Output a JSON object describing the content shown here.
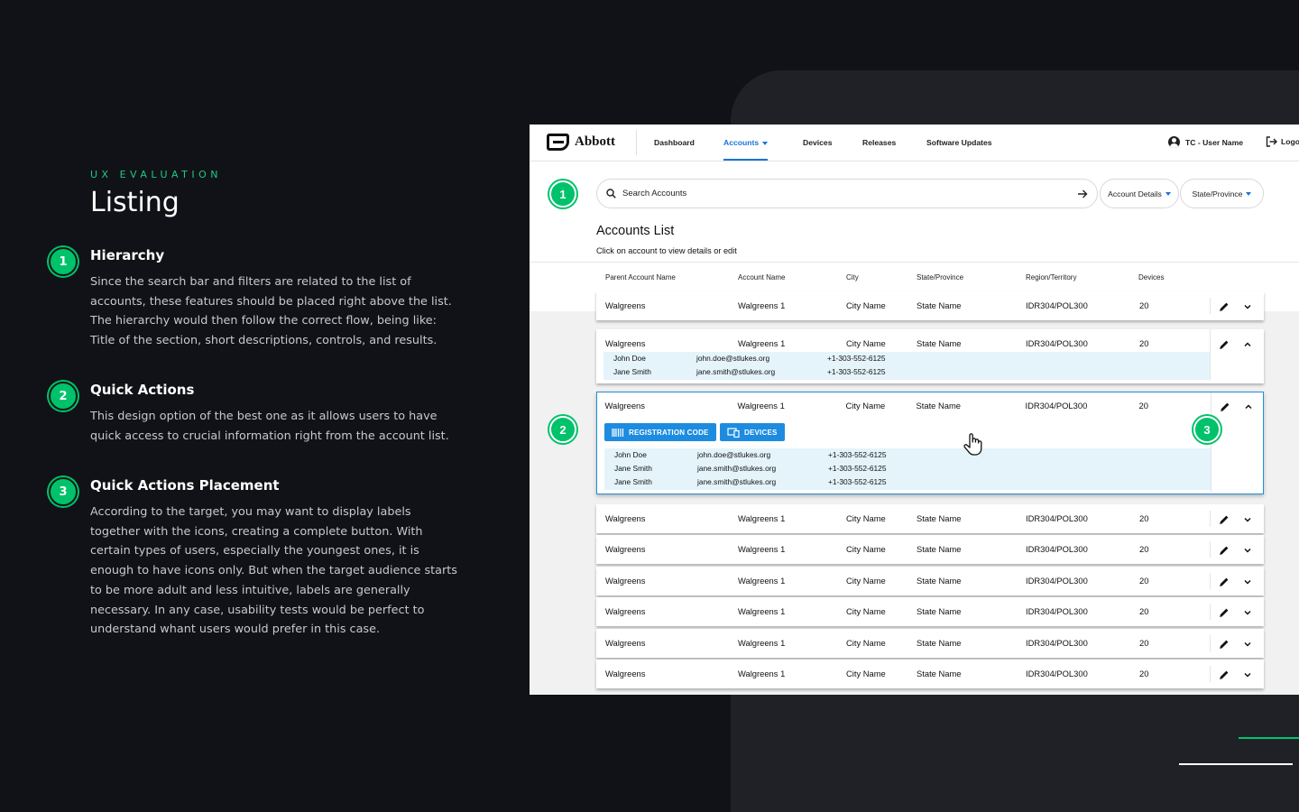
{
  "left": {
    "eyebrow": "UX EVALUATION",
    "title": "Listing",
    "sections": [
      {
        "number": "1",
        "heading": "Hierarchy",
        "body": "Since the search bar and filters are related to the list of accounts, these features should be placed right above the list. The hierarchy would then follow the correct flow, being like: Title of the section, short descriptions, controls, and results."
      },
      {
        "number": "2",
        "heading": "Quick Actions",
        "body": "This design option of the best one as it allows users to have quick access to crucial information right from the account list."
      },
      {
        "number": "3",
        "heading": "Quick Actions Placement",
        "body": "According to the target, you may want to display labels together with the icons, creating a complete button. With certain types of users, especially the youngest ones, it is enough to have icons only. But when the target audience starts to be more adult and less intuitive, labels are generally necessary. In any case, usability tests would be perfect to understand whant users would prefer in this case."
      }
    ]
  },
  "app": {
    "brand": "Abbott",
    "nav": [
      "Dashboard",
      "Accounts",
      "Devices",
      "Releases",
      "Software Updates"
    ],
    "active_nav": "Accounts",
    "user": "TC - User Name",
    "logout": "Logout",
    "search_placeholder": "Search Accounts",
    "filters": [
      "Account Details",
      "State/Province"
    ],
    "markers": [
      "1",
      "2",
      "3"
    ],
    "list_title": "Accounts List",
    "list_subtitle": "Click on account to view details or edit",
    "columns": [
      "Parent Account Name",
      "Account Name",
      "City",
      "State/Province",
      "Region/Territory",
      "Devices"
    ],
    "row": {
      "parent": "Walgreens",
      "account": "Walgreens 1",
      "city": "City Name",
      "state": "State Name",
      "region": "IDR304/POL300",
      "devices": "20"
    },
    "contacts": [
      {
        "name": "John Doe",
        "email": "john.doe@stlukes.org",
        "phone": "+1-303-552-6125"
      },
      {
        "name": "Jane Smith",
        "email": "jane.smith@stlukes.org",
        "phone": "+1-303-552-6125"
      }
    ],
    "quick_actions": {
      "registration": "REGISTRATION CODE",
      "devices": "DEVICES"
    },
    "colors": {
      "accent": "#1b74d6",
      "highlight": "#1e8fd8",
      "marker": "#00c26b",
      "contact_bg": "#e5f4fb"
    }
  }
}
